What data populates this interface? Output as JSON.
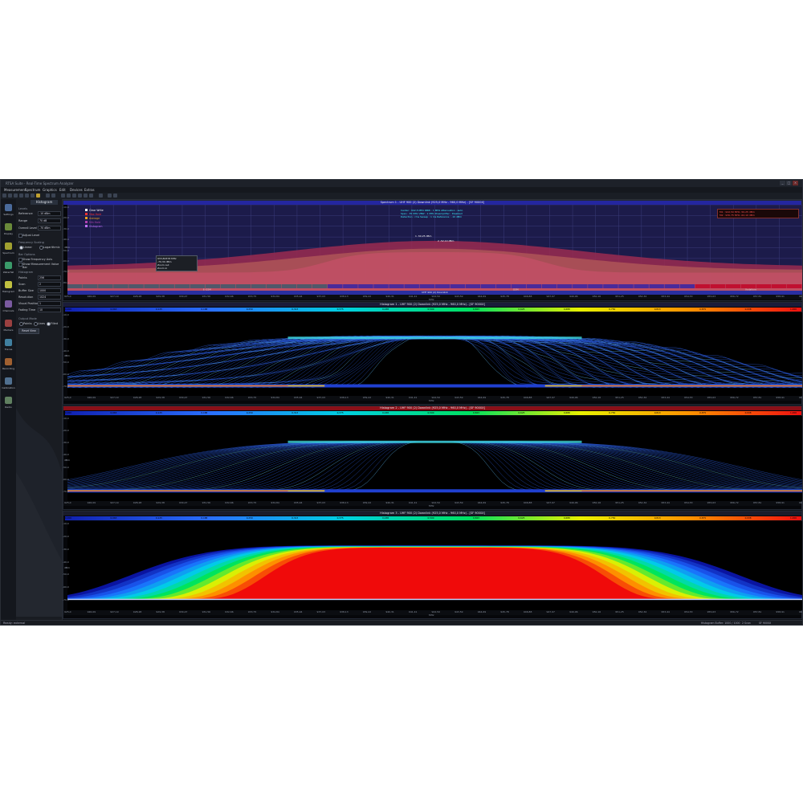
{
  "window": {
    "title": "RTSA Suite - Real-Time Spectrum Analyzer",
    "controls": [
      "_",
      "□",
      "×"
    ]
  },
  "menu": [
    "Measurement",
    "Spectrum",
    "Graphics",
    "Edit",
    "Devices",
    "Extras"
  ],
  "nav": [
    {
      "label": "Settings",
      "icon": "settings-icon",
      "color": "#4a6a9a"
    },
    {
      "label": "Display",
      "icon": "display-icon",
      "color": "#6a8a3a"
    },
    {
      "label": "Spectrum",
      "icon": "spectrum-icon",
      "color": "#a0a030"
    },
    {
      "label": "Waterfall",
      "icon": "waterfall-icon",
      "color": "#3a9a6a"
    },
    {
      "label": "Histogram",
      "icon": "histogram-icon",
      "color": "#c0c040"
    },
    {
      "label": "Channels",
      "icon": "channels-icon",
      "color": "#7a5aa0"
    },
    {
      "label": "Markers",
      "icon": "markers-icon",
      "color": "#9a4040"
    },
    {
      "label": "Traces",
      "icon": "traces-icon",
      "color": "#4080a0"
    },
    {
      "label": "Recording",
      "icon": "recording-icon",
      "color": "#a06030"
    },
    {
      "label": "Calibration",
      "icon": "calibration-icon",
      "color": "#507090"
    },
    {
      "label": "Radio",
      "icon": "radio-icon",
      "color": "#608060"
    }
  ],
  "panel": {
    "tab": "Histogram",
    "levels_heading": "Levels",
    "reference_label": "Reference",
    "reference_value": "-10 dBm",
    "range_label": "Range",
    "range_value": "70 dB",
    "overall_label": "Overall Level",
    "overall_value": "-70 dBm",
    "adjust_label": "Adjust Level",
    "freq_scaling_heading": "Frequency Scaling",
    "linear": "Linear",
    "logarithmic": "Logarithmic",
    "bar_options_heading": "Bar Options",
    "show_freq_axis": "Show Frequency Axis",
    "show_meas_bar": "Show Measurement Value Bar",
    "histogram_heading": "Histogram",
    "points_label": "Points",
    "points_value": "256",
    "scan_label": "Scan",
    "scan_value": "2",
    "buffer_label": "Buffer Size",
    "buffer_value": "1000",
    "resolution_label": "Resolution",
    "resolution_value": "1024",
    "visual_label": "Visual Position",
    "visual_value": "1",
    "fading_label": "Fading Time",
    "fading_value": "10",
    "output_heading": "Output Mode",
    "mode_points": "Points",
    "mode_lines": "Lines",
    "mode_filled": "Filled",
    "reset_button": "Reset View"
  },
  "spectrum": {
    "title": "Spectrum 1 - UHF 900 (2) Downlink (925,0 MHz - 960,0 MHz) - [SF 9000X]",
    "legend": [
      {
        "label": "Clear Write",
        "color": "#ffffff"
      },
      {
        "label": "Max Hold",
        "color": "#ff3030"
      },
      {
        "label": "Average",
        "color": "#e8a020"
      },
      {
        "label": "Min Hold",
        "color": "#b040b0"
      },
      {
        "label": "Histogram",
        "color": "#c070ff"
      }
    ],
    "info_lines": [
      "Center : 942,5 MHz   RBW : 1 MHz   Attenuation : auto",
      "Span : 35 MHz   VBW : 1 MHz   Preamplifier : Disabled",
      "Detection : rms   Sweep : 1 ms   Reference : -10 dBm"
    ],
    "marker_info": [
      "M1 : 942,50 MHz  -50,25 dBm",
      "M2 : 930,75 MHz  -62,10 dBm"
    ],
    "peak_markers": [
      "1 -50,25 dBm",
      "2 -52,10 dBm"
    ],
    "tooltip": [
      "933,80378 MHz",
      "-70,30 dBm",
      "Zoom out",
      "Zoom in"
    ],
    "y_unit": "dBm",
    "y_ticks": [
      "-10,0",
      "-20,0",
      "-30,0",
      "-40,0",
      "-50,0",
      "-60,0",
      "-70,0",
      "-80,0"
    ],
    "channel_labels": [
      "E-GSM",
      "GSM",
      "Vodafone"
    ],
    "channel_colors": [
      "#50586a",
      "#4a2a9a",
      "#c01030"
    ],
    "band_label": "UHF 900 (2) Downlink",
    "x_unit": "MHz"
  },
  "waterfalls": [
    {
      "title": "Histogram 1 - UHF 900 (2) Downlink (925,0 MHz - 960,0 MHz) - [SF 9000X]"
    },
    {
      "title": "Histogram 2 - UHF 900 (2) Downlink (925,0 MHz - 960,0 MHz) - [SF 9000X]"
    },
    {
      "title": "Histogram 3 - UHF 900 (2) Downlink (925,0 MHz - 960,0 MHz) - [SF 9000X]"
    }
  ],
  "histogram_axis": {
    "y_unit": "dBm",
    "y_ticks": [
      "-10,0",
      "-20,0",
      "-30,0",
      "-40,0",
      "-50,0",
      "-60,0",
      "-70,0"
    ],
    "x_unit": "MHz"
  },
  "x_ticks": [
    "925,0",
    "926,09",
    "927,19",
    "928,28",
    "929,38",
    "930,47",
    "931,56",
    "932,66",
    "933,75",
    "934,84",
    "935,94",
    "937,03",
    "938,13",
    "939,22",
    "940,31",
    "941,41",
    "942,50",
    "943,59",
    "944,69",
    "945,78",
    "946,88",
    "947,97",
    "949,06",
    "950,16",
    "951,25",
    "952,34",
    "953,44",
    "954,53",
    "955,63",
    "956,72",
    "957,81",
    "958,91",
    "960,0"
  ],
  "scale_values": [
    "0,000",
    "0,063",
    "0,125",
    "0,188",
    "0,250",
    "0,313",
    "0,375",
    "0,438",
    "0,500",
    "0,563",
    "0,625",
    "0,688",
    "0,750",
    "0,813",
    "0,875",
    "0,938",
    "1,000"
  ],
  "status": {
    "left": "Ready: external",
    "right": [
      "Histogram Buffer: 1000 / 1000",
      "2 Scan",
      "SF 9000X"
    ]
  }
}
